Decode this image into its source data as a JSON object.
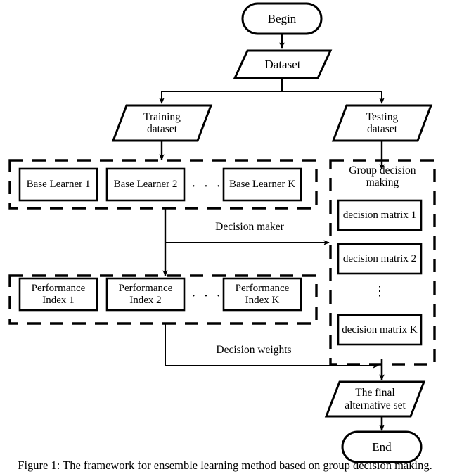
{
  "figure": {
    "caption": "Figure 1: The framework for ensemble learning method based on group decision making.",
    "colors": {
      "stroke": "#000000",
      "fill": "#ffffff",
      "text": "#000000"
    }
  },
  "flowchart": {
    "type": "flowchart",
    "start": {
      "label": "Begin",
      "shape": "terminator"
    },
    "dataset": {
      "label": "Dataset",
      "shape": "parallelogram"
    },
    "training": {
      "label": "Training\ndataset",
      "shape": "parallelogram"
    },
    "testing": {
      "label": "Testing\ndataset",
      "shape": "parallelogram"
    },
    "base_learners": {
      "group_shape": "dashed-rect",
      "items": [
        {
          "label": "Base Learner 1"
        },
        {
          "label": "Base Learner 2"
        },
        {
          "label": "Base Learner K"
        }
      ],
      "ellipsis": "· · ·"
    },
    "performance_indices": {
      "group_shape": "dashed-rect",
      "items": [
        {
          "label": "Performance\nIndex 1"
        },
        {
          "label": "Performance\nIndex 2"
        },
        {
          "label": "Performance\nIndex K"
        }
      ],
      "ellipsis": "· · ·"
    },
    "group_decision": {
      "title": "Group decision\nmaking",
      "group_shape": "dashed-rect",
      "items": [
        {
          "label": "decision matrix 1"
        },
        {
          "label": "decision matrix 2"
        },
        {
          "label": "decision matrix K"
        }
      ],
      "ellipsis": "⋮"
    },
    "final": {
      "label": "The final\nalternative set",
      "shape": "parallelogram"
    },
    "end": {
      "label": "End",
      "shape": "terminator"
    },
    "edges": [
      {
        "id": "begin-dataset",
        "label": ""
      },
      {
        "id": "dataset-training",
        "label": ""
      },
      {
        "id": "dataset-testing",
        "label": ""
      },
      {
        "id": "training-baselearners",
        "label": ""
      },
      {
        "id": "testing-groupdecision",
        "label": ""
      },
      {
        "id": "baselearners-performance",
        "label": ""
      },
      {
        "id": "baselearners-groupdecision",
        "label": "Decision maker"
      },
      {
        "id": "performance-final",
        "label": "Decision weights"
      },
      {
        "id": "groupdecision-final",
        "label": ""
      },
      {
        "id": "final-end",
        "label": ""
      }
    ]
  }
}
